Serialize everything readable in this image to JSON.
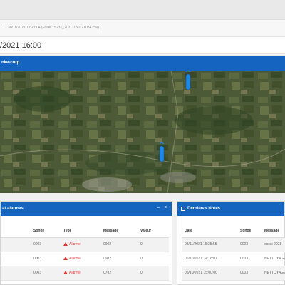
{
  "info_line": "1 : 30/11/2021 12:21:04 (Fuller : 5231_20211130121034.csv)",
  "datetime": "/2021 16:00",
  "map_header": "nke-corp",
  "colors": {
    "accent": "#1565c0",
    "alarm": "#e53935",
    "marker": "#1e88e5"
  },
  "alarms": {
    "title": "at alarmes",
    "minimize_icon": "minimize-icon",
    "close_icon": "close-icon",
    "columns": [
      "Sonde",
      "Type",
      "Message",
      "Valeur"
    ],
    "rows": [
      {
        "sonde": "0003",
        "type": "Alarme",
        "message": "0902",
        "valeur": "0"
      },
      {
        "sonde": "0003",
        "type": "Alarme",
        "message": "0982",
        "valeur": "0"
      },
      {
        "sonde": "0003",
        "type": "Alarme",
        "message": "0782",
        "valeur": "0"
      }
    ]
  },
  "notes": {
    "title": "Dernières Notes",
    "columns": [
      "Date",
      "Sonde",
      "Message"
    ],
    "rows": [
      {
        "date": "03/11/2021 15:35:55",
        "sonde": "0003",
        "message": "essai 2021"
      },
      {
        "date": "06/10/2021 14:18:07",
        "sonde": "0003",
        "message": "NETTOYAGE"
      },
      {
        "date": "05/10/2021 15:00:00",
        "sonde": "0003",
        "message": "NETTOYAGE"
      }
    ]
  }
}
